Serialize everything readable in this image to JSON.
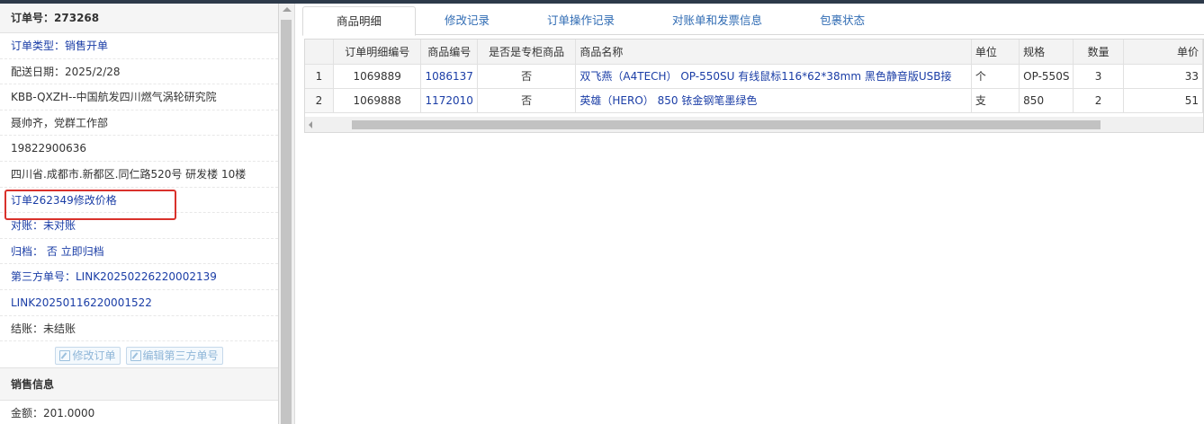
{
  "order": {
    "header_label": "订单号：",
    "header_number": "273268",
    "rows": [
      {
        "text": "订单类型：销售开单",
        "blue": true
      },
      {
        "text": "配送日期：2025/2/28",
        "blue": false
      },
      {
        "text": "KBB-QXZH--中国航发四川燃气涡轮研究院",
        "blue": false
      },
      {
        "text": "聂帅齐，党群工作部",
        "blue": false
      },
      {
        "text": "19822900636",
        "blue": false
      },
      {
        "text": "四川省.成都市.新都区.同仁路520号 研发楼 10楼",
        "blue": false
      },
      {
        "text": "订单262349修改价格",
        "blue": true
      },
      {
        "text": "对账：未对账",
        "blue": true
      },
      {
        "text": "归档：  否 立即归档",
        "blue": true
      },
      {
        "text": "第三方单号：LINK20250226220002139",
        "blue": true
      },
      {
        "text": "LINK20250116220001522",
        "blue": true
      },
      {
        "text": "结账：未结账",
        "blue": false
      }
    ],
    "buttons": {
      "edit_order": "修改订单",
      "edit_third_party": "编辑第三方单号"
    },
    "sales_section": "销售信息",
    "amount": "金额：201.0000"
  },
  "tabs": [
    {
      "label": "商品明细",
      "active": true
    },
    {
      "label": "修改记录",
      "active": false
    },
    {
      "label": "订单操作记录",
      "active": false
    },
    {
      "label": "对账单和发票信息",
      "active": false
    },
    {
      "label": "包裹状态",
      "active": false
    }
  ],
  "table": {
    "headers": [
      "",
      "订单明细编号",
      "商品编号",
      "是否是专柜商品",
      "商品名称",
      "单位",
      "规格",
      "数量",
      "单价"
    ],
    "rows": [
      [
        "1",
        "1069889",
        "1086137",
        "否",
        "双飞燕（A4TECH） OP-550SU 有线鼠标116*62*38mm 黑色静音版USB接",
        "个",
        "OP-550S",
        "3",
        "33"
      ],
      [
        "2",
        "1069888",
        "1172010",
        "否",
        "英雄（HERO） 850 铱金钢笔墨绿色",
        "支",
        "850",
        "2",
        "51"
      ]
    ]
  }
}
